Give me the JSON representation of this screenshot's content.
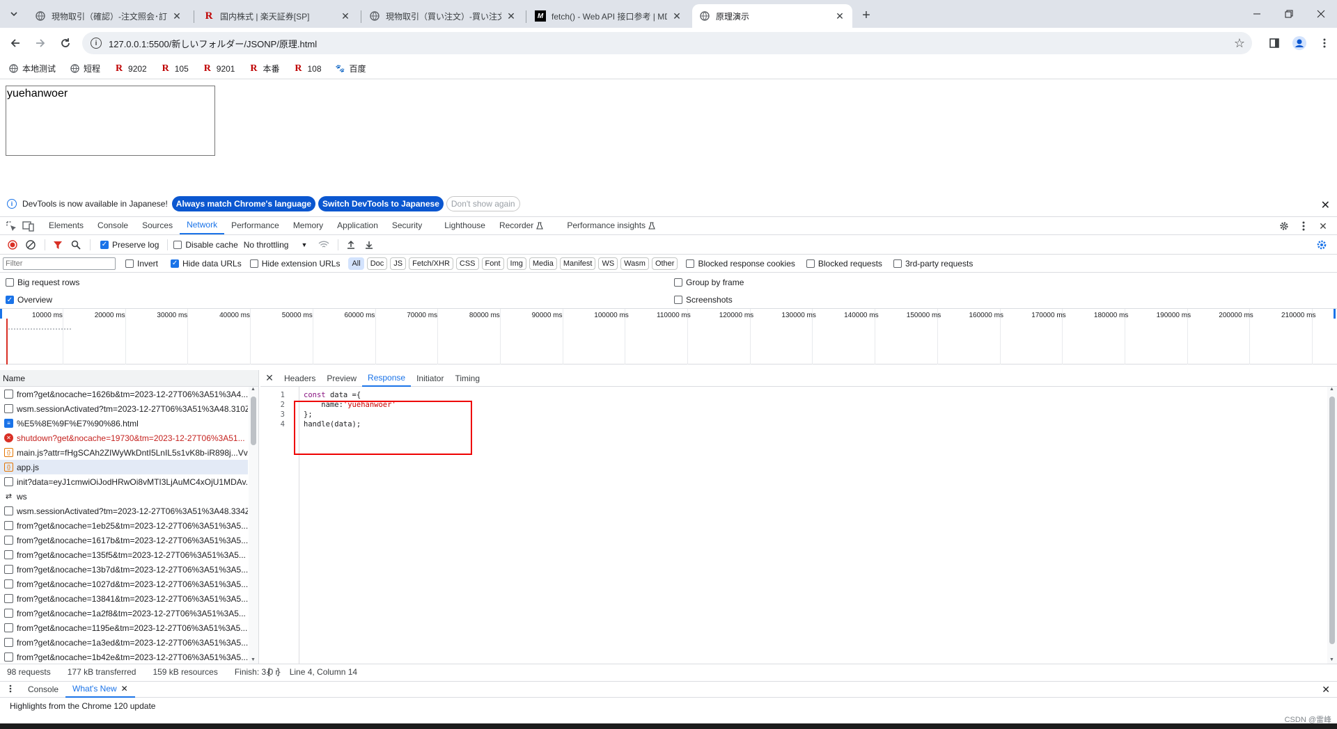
{
  "browser": {
    "tabs": [
      {
        "title": "現物取引（確認）-注文照会･訂",
        "favicon": "globe-icon",
        "active": false
      },
      {
        "title": "国内株式 | 楽天証券[SP]",
        "favicon": "rakuten-r-icon",
        "active": false
      },
      {
        "title": "現物取引（買い注文）-買い注文",
        "favicon": "globe-icon",
        "active": false
      },
      {
        "title": "fetch() - Web API 接口参考 | MDN",
        "favicon": "mdn-icon",
        "active": false
      },
      {
        "title": "原理演示",
        "favicon": "globe-icon",
        "active": true
      }
    ],
    "url": "127.0.0.1:5500/新しいフォルダー/JSONP/原理.html",
    "bookmarks": [
      {
        "label": "本地测试",
        "icon": "globe-icon"
      },
      {
        "label": "短程",
        "icon": "globe-icon"
      },
      {
        "label": "9202",
        "icon": "rakuten-r-icon"
      },
      {
        "label": "105",
        "icon": "rakuten-r-icon"
      },
      {
        "label": "9201",
        "icon": "rakuten-r-icon"
      },
      {
        "label": "本番",
        "icon": "rakuten-r-icon"
      },
      {
        "label": "108",
        "icon": "rakuten-r-icon"
      },
      {
        "label": "百度",
        "icon": "baidu-paw-icon"
      }
    ]
  },
  "page": {
    "box_text": "yuehanwoer"
  },
  "devtools": {
    "lang_banner": {
      "message": "DevTools is now available in Japanese!",
      "btn_match": "Always match Chrome's language",
      "btn_switch": "Switch DevTools to Japanese",
      "btn_dismiss": "Don't show again"
    },
    "panels": [
      "Elements",
      "Console",
      "Sources",
      "Network",
      "Performance",
      "Memory",
      "Application",
      "Security",
      "Lighthouse",
      "Recorder",
      "Performance insights"
    ],
    "active_panel": "Network",
    "network_toolbar": {
      "preserve_log": "Preserve log",
      "disable_cache": "Disable cache",
      "throttling": "No throttling"
    },
    "filter": {
      "placeholder": "Filter",
      "invert": "Invert",
      "hide_data_urls": "Hide data URLs",
      "hide_ext_urls": "Hide extension URLs",
      "types": [
        "All",
        "Doc",
        "JS",
        "Fetch/XHR",
        "CSS",
        "Font",
        "Img",
        "Media",
        "Manifest",
        "WS",
        "Wasm",
        "Other"
      ],
      "blocked_cookies": "Blocked response cookies",
      "blocked_requests": "Blocked requests",
      "third_party": "3rd-party requests"
    },
    "options": {
      "big_rows": "Big request rows",
      "overview": "Overview",
      "group_by_frame": "Group by frame",
      "screenshots": "Screenshots"
    },
    "timeline_ticks": [
      "10000 ms",
      "20000 ms",
      "30000 ms",
      "40000 ms",
      "50000 ms",
      "60000 ms",
      "70000 ms",
      "80000 ms",
      "90000 ms",
      "100000 ms",
      "110000 ms",
      "120000 ms",
      "130000 ms",
      "140000 ms",
      "150000 ms",
      "160000 ms",
      "170000 ms",
      "180000 ms",
      "190000 ms",
      "200000 ms",
      "210000 ms"
    ],
    "requests_header": "Name",
    "requests": [
      {
        "name": "from?get&nocache=1626b&tm=2023-12-27T06%3A51%3A4...",
        "type": "doc-plain"
      },
      {
        "name": "wsm.sessionActivated?tm=2023-12-27T06%3A51%3A48.310Z",
        "type": "doc-plain"
      },
      {
        "name": "%E5%8E%9F%E7%90%86.html",
        "type": "doc"
      },
      {
        "name": "shutdown?get&nocache=19730&tm=2023-12-27T06%3A51...",
        "type": "err"
      },
      {
        "name": "main.js?attr=fHgSCAh2ZIWyWkDntI5LnIL5s1vK8b-iR898j...Vv...",
        "type": "js"
      },
      {
        "name": "app.js",
        "type": "js-sel"
      },
      {
        "name": "init?data=eyJ1cmwiOiJodHRwOi8vMTI3LjAuMC4xOjU1MDAv...",
        "type": "doc-plain"
      },
      {
        "name": "ws",
        "type": "ws"
      },
      {
        "name": "wsm.sessionActivated?tm=2023-12-27T06%3A51%3A48.334Z",
        "type": "doc-plain"
      },
      {
        "name": "from?get&nocache=1eb25&tm=2023-12-27T06%3A51%3A5...",
        "type": "doc-plain"
      },
      {
        "name": "from?get&nocache=1617b&tm=2023-12-27T06%3A51%3A5...",
        "type": "doc-plain"
      },
      {
        "name": "from?get&nocache=135f5&tm=2023-12-27T06%3A51%3A5...",
        "type": "doc-plain"
      },
      {
        "name": "from?get&nocache=13b7d&tm=2023-12-27T06%3A51%3A5...",
        "type": "doc-plain"
      },
      {
        "name": "from?get&nocache=1027d&tm=2023-12-27T06%3A51%3A5...",
        "type": "doc-plain"
      },
      {
        "name": "from?get&nocache=13841&tm=2023-12-27T06%3A51%3A5...",
        "type": "doc-plain"
      },
      {
        "name": "from?get&nocache=1a2f8&tm=2023-12-27T06%3A51%3A5...",
        "type": "doc-plain"
      },
      {
        "name": "from?get&nocache=1195e&tm=2023-12-27T06%3A51%3A5...",
        "type": "doc-plain"
      },
      {
        "name": "from?get&nocache=1a3ed&tm=2023-12-27T06%3A51%3A5...",
        "type": "doc-plain"
      },
      {
        "name": "from?get&nocache=1b42e&tm=2023-12-27T06%3A51%3A5...",
        "type": "doc-plain"
      }
    ],
    "detail_tabs": [
      "Headers",
      "Preview",
      "Response",
      "Initiator",
      "Timing"
    ],
    "active_detail_tab": "Response",
    "response_lines": [
      {
        "num": "1",
        "parts": [
          {
            "t": "const ",
            "c": "kw"
          },
          {
            "t": "data",
            "c": ""
          },
          {
            "t": " ={",
            "c": ""
          }
        ]
      },
      {
        "num": "2",
        "parts": [
          {
            "t": "    name:",
            "c": ""
          },
          {
            "t": "'yuehanwoer'",
            "c": "str"
          }
        ]
      },
      {
        "num": "3",
        "parts": [
          {
            "t": "};",
            "c": ""
          }
        ]
      },
      {
        "num": "4",
        "parts": [
          {
            "t": "handle(data);",
            "c": ""
          }
        ]
      }
    ],
    "status": {
      "requests": "98 requests",
      "transferred": "177 kB transferred",
      "resources": "159 kB resources",
      "finish": "Finish: 3.0 r",
      "cursor": "Line 4, Column 14"
    },
    "drawer_tabs": [
      "Console",
      "What's New"
    ],
    "active_drawer_tab": "What's New",
    "drawer_text": "Highlights from the Chrome 120 update"
  },
  "watermark": "CSDN @雷峰"
}
